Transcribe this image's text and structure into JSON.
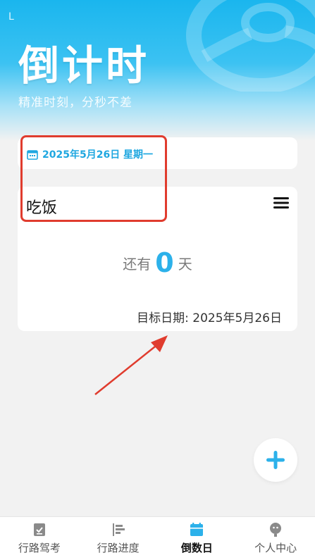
{
  "status": {
    "left_indicator": "L"
  },
  "hero": {
    "title": "倒计时",
    "subtitle": "精准时刻，分秒不差"
  },
  "date_bar": {
    "date_text": "2025年5月26日 星期一"
  },
  "event": {
    "title": "吃饭",
    "prefix": "还有",
    "days": "0",
    "suffix": "天",
    "target_label": "目标日期: 2025年5月26日"
  },
  "tabs": [
    {
      "label": "行路驾考",
      "icon": "checklist-icon"
    },
    {
      "label": "行路进度",
      "icon": "progress-bars-icon"
    },
    {
      "label": "倒数日",
      "icon": "calendar-icon",
      "active": true
    },
    {
      "label": "个人中心",
      "icon": "person-icon"
    }
  ],
  "colors": {
    "accent": "#2cb1ea",
    "annotation": "#e03c2e"
  }
}
